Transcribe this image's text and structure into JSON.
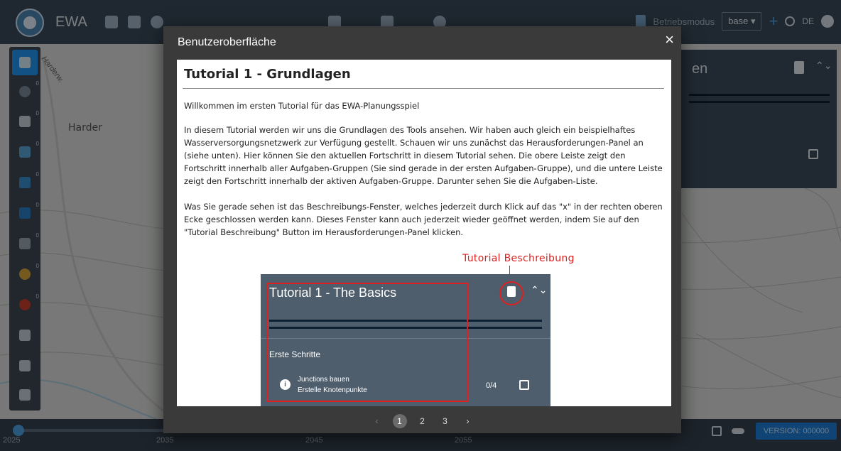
{
  "app": {
    "title": "EWA"
  },
  "topbar": {
    "mode_label": "Betriebsmodus",
    "base_select": "base ▾",
    "add_label": "+",
    "language": "DE"
  },
  "map": {
    "place": "Harder",
    "street": "Harderw."
  },
  "toolbar": {
    "badges": [
      "0",
      "0",
      "0",
      "0",
      "0",
      "0",
      "0",
      "0"
    ]
  },
  "side_panel": {
    "title_fragment": "en"
  },
  "timeline": {
    "years": [
      "2025",
      "2035",
      "2045",
      "2055"
    ],
    "version": "VERSION: 000000"
  },
  "dialog": {
    "title": "Benutzeroberfläche",
    "close_label": "×",
    "heading": "Tutorial 1 - Grundlagen",
    "paragraphs": [
      "Willkommen im ersten Tutorial für das EWA-Planungsspiel",
      "In diesem Tutorial werden wir uns die Grundlagen des Tools ansehen. Wir haben auch gleich ein beispielhaftes Wasserversorgungsnetzwerk zur Verfügung gestellt. Schauen wir uns zunächst das Herausforderungen-Panel an (siehe unten). Hier können Sie den aktuellen Fortschritt in diesem Tutorial sehen. Die obere Leiste zeigt den Fortschritt innerhalb aller Aufgaben-Gruppen (Sie sind gerade in der ersten Aufgaben-Gruppe), und die untere Leiste zeigt den Fortschritt innerhalb der aktiven Aufgaben-Gruppe. Darunter sehen Sie die Aufgaben-Liste.",
      "Was Sie gerade sehen ist das Beschreibungs-Fenster, welches jederzeit durch Klick auf das \"x\" in der rechten oberen Ecke geschlossen werden kann. Dieses Fenster kann auch jederzeit wieder geöffnet werden, indem Sie auf den \"Tutorial Beschreibung\" Button im Herausforderungen-Panel klicken."
    ],
    "annotation": "Tutorial Beschreibung",
    "screenshot": {
      "title": "Tutorial 1 - The Basics",
      "section": "Erste Schritte",
      "task_title": "Junctions bauen",
      "task_subtitle": "Erstelle Knotenpunkte",
      "count": "0/4",
      "collapse": "⌃⌄",
      "info": "i"
    },
    "pagination": {
      "prev": "‹",
      "pages": [
        "1",
        "2",
        "3"
      ],
      "current": "1",
      "next": "›"
    }
  },
  "colors": {
    "accent": "#2196f3",
    "annotation_red": "#e02020",
    "topbar": "#3a4a5a",
    "dialog_bg": "#3a3a3a"
  }
}
